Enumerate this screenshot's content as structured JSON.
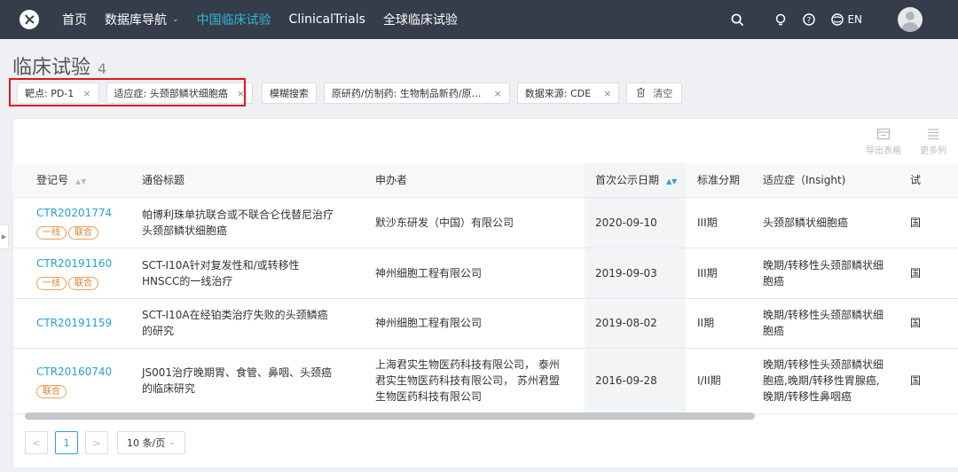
{
  "nav": {
    "items": [
      {
        "label": "首页",
        "active": false,
        "caret": false
      },
      {
        "label": "数据库导航",
        "active": false,
        "caret": true
      },
      {
        "label": "中国临床试验",
        "active": true,
        "caret": false
      },
      {
        "label": "ClinicalTrials",
        "active": false,
        "caret": false
      },
      {
        "label": "全球临床试验",
        "active": false,
        "caret": false
      }
    ],
    "lang": "EN"
  },
  "page": {
    "title": "临床试验",
    "count": "4"
  },
  "filters": {
    "tags": [
      {
        "label": "靶点: PD-1",
        "close": "×"
      },
      {
        "label": "适应症: 头颈部鳞状细胞癌",
        "close": "×"
      }
    ],
    "fuzzy_search": "模糊搜索",
    "tags2": [
      {
        "label": "原研药/仿制药: 生物制品新药/原…",
        "close": "×"
      },
      {
        "label": "数据来源: CDE",
        "close": "×"
      }
    ],
    "clear": "清空"
  },
  "tools": {
    "export": "导出表格",
    "more_columns": "更多列"
  },
  "table": {
    "headers": [
      "登记号",
      "通俗标题",
      "申办者",
      "首次公示日期",
      "标准分期",
      "适应症（Insight)",
      "试"
    ],
    "rows": [
      {
        "reg": "CTR20201774",
        "badges": [
          "一线",
          "联合"
        ],
        "title": "帕博利珠单抗联合或不联合仑伐替尼治疗头颈部鳞状细胞癌",
        "sponsor": "默沙东研发（中国）有限公司",
        "date": "2020-09-10",
        "phase": "III期",
        "indication": "头颈部鳞状细胞癌",
        "extra": "国"
      },
      {
        "reg": "CTR20191160",
        "badges": [
          "一线",
          "联合"
        ],
        "title": "SCT-I10A针对复发性和/或转移性HNSCC的一线治疗",
        "sponsor": "神州细胞工程有限公司",
        "date": "2019-09-03",
        "phase": "III期",
        "indication": "晚期/转移性头颈部鳞状细胞癌",
        "extra": "国"
      },
      {
        "reg": "CTR20191159",
        "badges": [],
        "title": "SCT-I10A在经铂类治疗失败的头颈鳞癌的研究",
        "sponsor": "神州细胞工程有限公司",
        "date": "2019-08-02",
        "phase": "II期",
        "indication": "晚期/转移性头颈部鳞状细胞癌",
        "extra": "国"
      },
      {
        "reg": "CTR20160740",
        "badges": [
          "联合"
        ],
        "title": "JS001治疗晚期胃、食管、鼻咽、头颈癌的临床研究",
        "sponsor": "上海君实生物医药科技有限公司， 泰州君实生物医药科技有限公司， 苏州君盟生物医药科技有限公司",
        "date": "2016-09-28",
        "phase": "I/II期",
        "indication": "晚期/转移性头颈部鳞状细胞癌,晚期/转移性胃腺癌,晚期/转移性鼻咽癌",
        "extra": "国"
      }
    ]
  },
  "pagination": {
    "prev": "<",
    "current": "1",
    "next": ">",
    "page_size": "10 条/页"
  },
  "colors": {
    "nav_bg": "#353c4a",
    "accent": "#2a9fd6",
    "nav_active": "#2fb8d4",
    "badge": "#d9822b",
    "highlight": "#e5141f"
  }
}
